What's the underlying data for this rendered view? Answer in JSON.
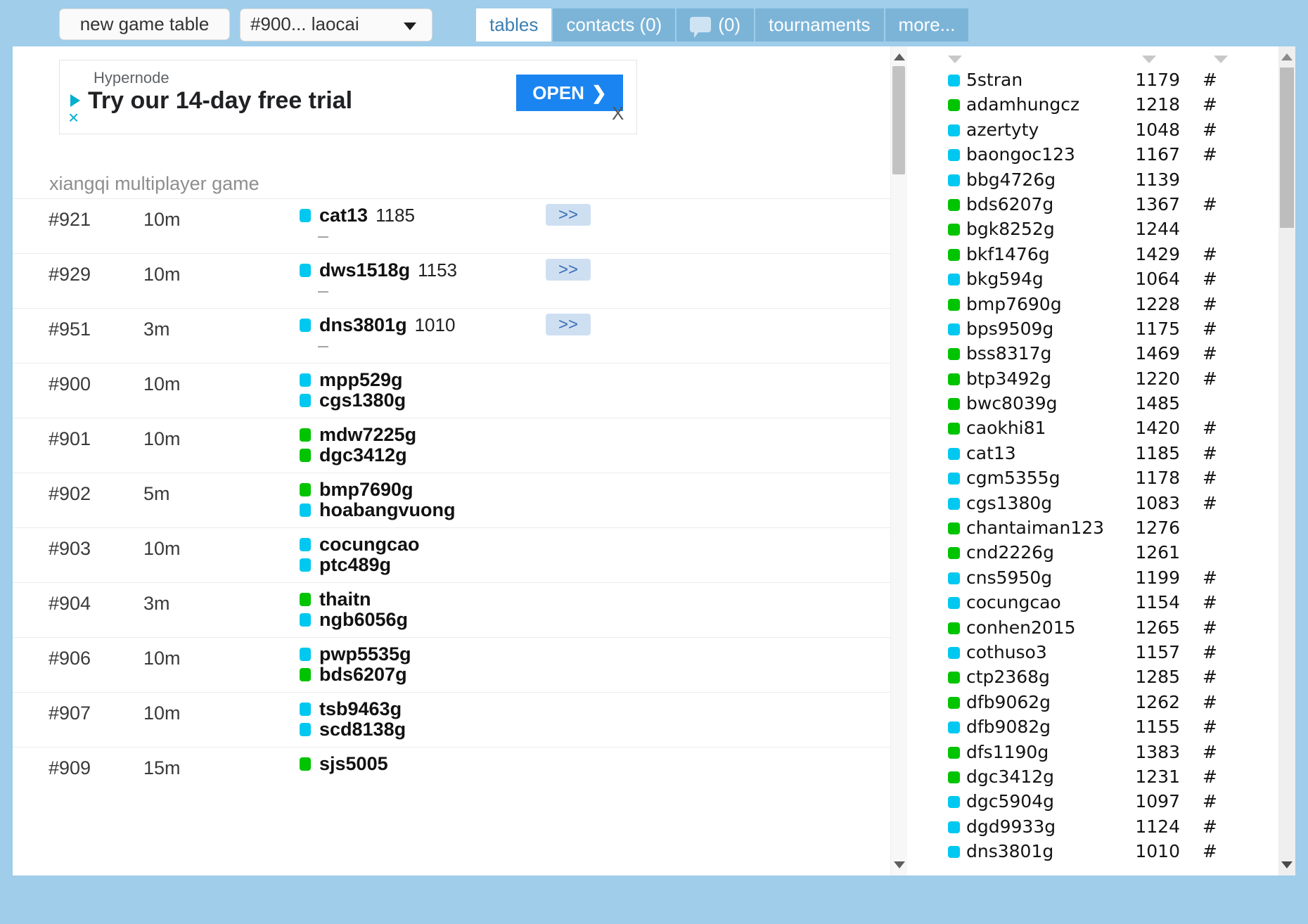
{
  "toolbar": {
    "new_game_table_label": "new game table",
    "table_select_value": "#900... laocai",
    "caret_icon": "chevron-down-icon"
  },
  "tabs": [
    {
      "label": "tables",
      "active": true,
      "icon": null
    },
    {
      "label": "contacts (0)",
      "active": false,
      "icon": null
    },
    {
      "label": "(0)",
      "active": false,
      "icon": "chat-bubble-icon"
    },
    {
      "label": "tournaments",
      "active": false,
      "icon": null
    },
    {
      "label": "more...",
      "active": false,
      "icon": null
    }
  ],
  "ad": {
    "brand": "Hypernode",
    "headline": "Try our 14-day free trial",
    "cta_label": "OPEN",
    "cta_arrow": "❯",
    "adchoices_icon": "adchoices-triangle-icon",
    "dismiss_label": "×",
    "close_label": "X"
  },
  "main": {
    "subtitle": "xiangqi multiplayer game",
    "join_button_label": ">>",
    "empty_seat_label": "–"
  },
  "colors": {
    "accent_blue": "#7cb4d8",
    "page_background": "#9fcdea",
    "player_cyan": "#00c8f0",
    "player_green": "#00c400",
    "join_button_bg": "#cfdff2",
    "join_button_fg": "#3a6fb5",
    "ad_cta_bg": "#1a85f0"
  },
  "tables": [
    {
      "id": "#921",
      "time": "10m",
      "players": [
        {
          "name": "cat13",
          "color": "cyan",
          "rating": "1185"
        }
      ],
      "empty_seat": true,
      "join": true
    },
    {
      "id": "#929",
      "time": "10m",
      "players": [
        {
          "name": "dws1518g",
          "color": "cyan",
          "rating": "1153"
        }
      ],
      "empty_seat": true,
      "join": true
    },
    {
      "id": "#951",
      "time": "3m",
      "players": [
        {
          "name": "dns3801g",
          "color": "cyan",
          "rating": "1010"
        }
      ],
      "empty_seat": true,
      "join": true
    },
    {
      "id": "#900",
      "time": "10m",
      "players": [
        {
          "name": "mpp529g",
          "color": "cyan",
          "rating": ""
        },
        {
          "name": "cgs1380g",
          "color": "cyan",
          "rating": ""
        }
      ],
      "empty_seat": false,
      "join": false
    },
    {
      "id": "#901",
      "time": "10m",
      "players": [
        {
          "name": "mdw7225g",
          "color": "green",
          "rating": ""
        },
        {
          "name": "dgc3412g",
          "color": "green",
          "rating": ""
        }
      ],
      "empty_seat": false,
      "join": false
    },
    {
      "id": "#902",
      "time": "5m",
      "players": [
        {
          "name": "bmp7690g",
          "color": "green",
          "rating": ""
        },
        {
          "name": "hoabangvuong",
          "color": "cyan",
          "rating": ""
        }
      ],
      "empty_seat": false,
      "join": false
    },
    {
      "id": "#903",
      "time": "10m",
      "players": [
        {
          "name": "cocungcao",
          "color": "cyan",
          "rating": ""
        },
        {
          "name": "ptc489g",
          "color": "cyan",
          "rating": ""
        }
      ],
      "empty_seat": false,
      "join": false
    },
    {
      "id": "#904",
      "time": "3m",
      "players": [
        {
          "name": "thaitn",
          "color": "green",
          "rating": ""
        },
        {
          "name": "ngb6056g",
          "color": "cyan",
          "rating": ""
        }
      ],
      "empty_seat": false,
      "join": false
    },
    {
      "id": "#906",
      "time": "10m",
      "players": [
        {
          "name": "pwp5535g",
          "color": "cyan",
          "rating": ""
        },
        {
          "name": "bds6207g",
          "color": "green",
          "rating": ""
        }
      ],
      "empty_seat": false,
      "join": false
    },
    {
      "id": "#907",
      "time": "10m",
      "players": [
        {
          "name": "tsb9463g",
          "color": "cyan",
          "rating": ""
        },
        {
          "name": "scd8138g",
          "color": "cyan",
          "rating": ""
        }
      ],
      "empty_seat": false,
      "join": false
    },
    {
      "id": "#909",
      "time": "15m",
      "players": [
        {
          "name": "sjs5005",
          "color": "green",
          "rating": ""
        }
      ],
      "empty_seat": false,
      "join": false
    }
  ],
  "players": [
    {
      "name": "5stran",
      "color": "cyan",
      "rating": "1179",
      "hash": "#"
    },
    {
      "name": "adamhungcz",
      "color": "green",
      "rating": "1218",
      "hash": "#"
    },
    {
      "name": "azertyty",
      "color": "cyan",
      "rating": "1048",
      "hash": "#"
    },
    {
      "name": "baongoc123",
      "color": "cyan",
      "rating": "1167",
      "hash": "#"
    },
    {
      "name": "bbg4726g",
      "color": "cyan",
      "rating": "1139",
      "hash": ""
    },
    {
      "name": "bds6207g",
      "color": "green",
      "rating": "1367",
      "hash": "#"
    },
    {
      "name": "bgk8252g",
      "color": "green",
      "rating": "1244",
      "hash": ""
    },
    {
      "name": "bkf1476g",
      "color": "green",
      "rating": "1429",
      "hash": "#"
    },
    {
      "name": "bkg594g",
      "color": "cyan",
      "rating": "1064",
      "hash": "#"
    },
    {
      "name": "bmp7690g",
      "color": "green",
      "rating": "1228",
      "hash": "#"
    },
    {
      "name": "bps9509g",
      "color": "cyan",
      "rating": "1175",
      "hash": "#"
    },
    {
      "name": "bss8317g",
      "color": "green",
      "rating": "1469",
      "hash": "#"
    },
    {
      "name": "btp3492g",
      "color": "green",
      "rating": "1220",
      "hash": "#"
    },
    {
      "name": "bwc8039g",
      "color": "green",
      "rating": "1485",
      "hash": ""
    },
    {
      "name": "caokhi81",
      "color": "green",
      "rating": "1420",
      "hash": "#"
    },
    {
      "name": "cat13",
      "color": "cyan",
      "rating": "1185",
      "hash": "#"
    },
    {
      "name": "cgm5355g",
      "color": "cyan",
      "rating": "1178",
      "hash": "#"
    },
    {
      "name": "cgs1380g",
      "color": "cyan",
      "rating": "1083",
      "hash": "#"
    },
    {
      "name": "chantaiman123",
      "color": "green",
      "rating": "1276",
      "hash": ""
    },
    {
      "name": "cnd2226g",
      "color": "green",
      "rating": "1261",
      "hash": ""
    },
    {
      "name": "cns5950g",
      "color": "cyan",
      "rating": "1199",
      "hash": "#"
    },
    {
      "name": "cocungcao",
      "color": "cyan",
      "rating": "1154",
      "hash": "#"
    },
    {
      "name": "conhen2015",
      "color": "green",
      "rating": "1265",
      "hash": "#"
    },
    {
      "name": "cothuso3",
      "color": "cyan",
      "rating": "1157",
      "hash": "#"
    },
    {
      "name": "ctp2368g",
      "color": "green",
      "rating": "1285",
      "hash": "#"
    },
    {
      "name": "dfb9062g",
      "color": "green",
      "rating": "1262",
      "hash": "#"
    },
    {
      "name": "dfb9082g",
      "color": "cyan",
      "rating": "1155",
      "hash": "#"
    },
    {
      "name": "dfs1190g",
      "color": "green",
      "rating": "1383",
      "hash": "#"
    },
    {
      "name": "dgc3412g",
      "color": "green",
      "rating": "1231",
      "hash": "#"
    },
    {
      "name": "dgc5904g",
      "color": "cyan",
      "rating": "1097",
      "hash": "#"
    },
    {
      "name": "dgd9933g",
      "color": "cyan",
      "rating": "1124",
      "hash": "#"
    },
    {
      "name": "dns3801g",
      "color": "cyan",
      "rating": "1010",
      "hash": "#"
    }
  ]
}
